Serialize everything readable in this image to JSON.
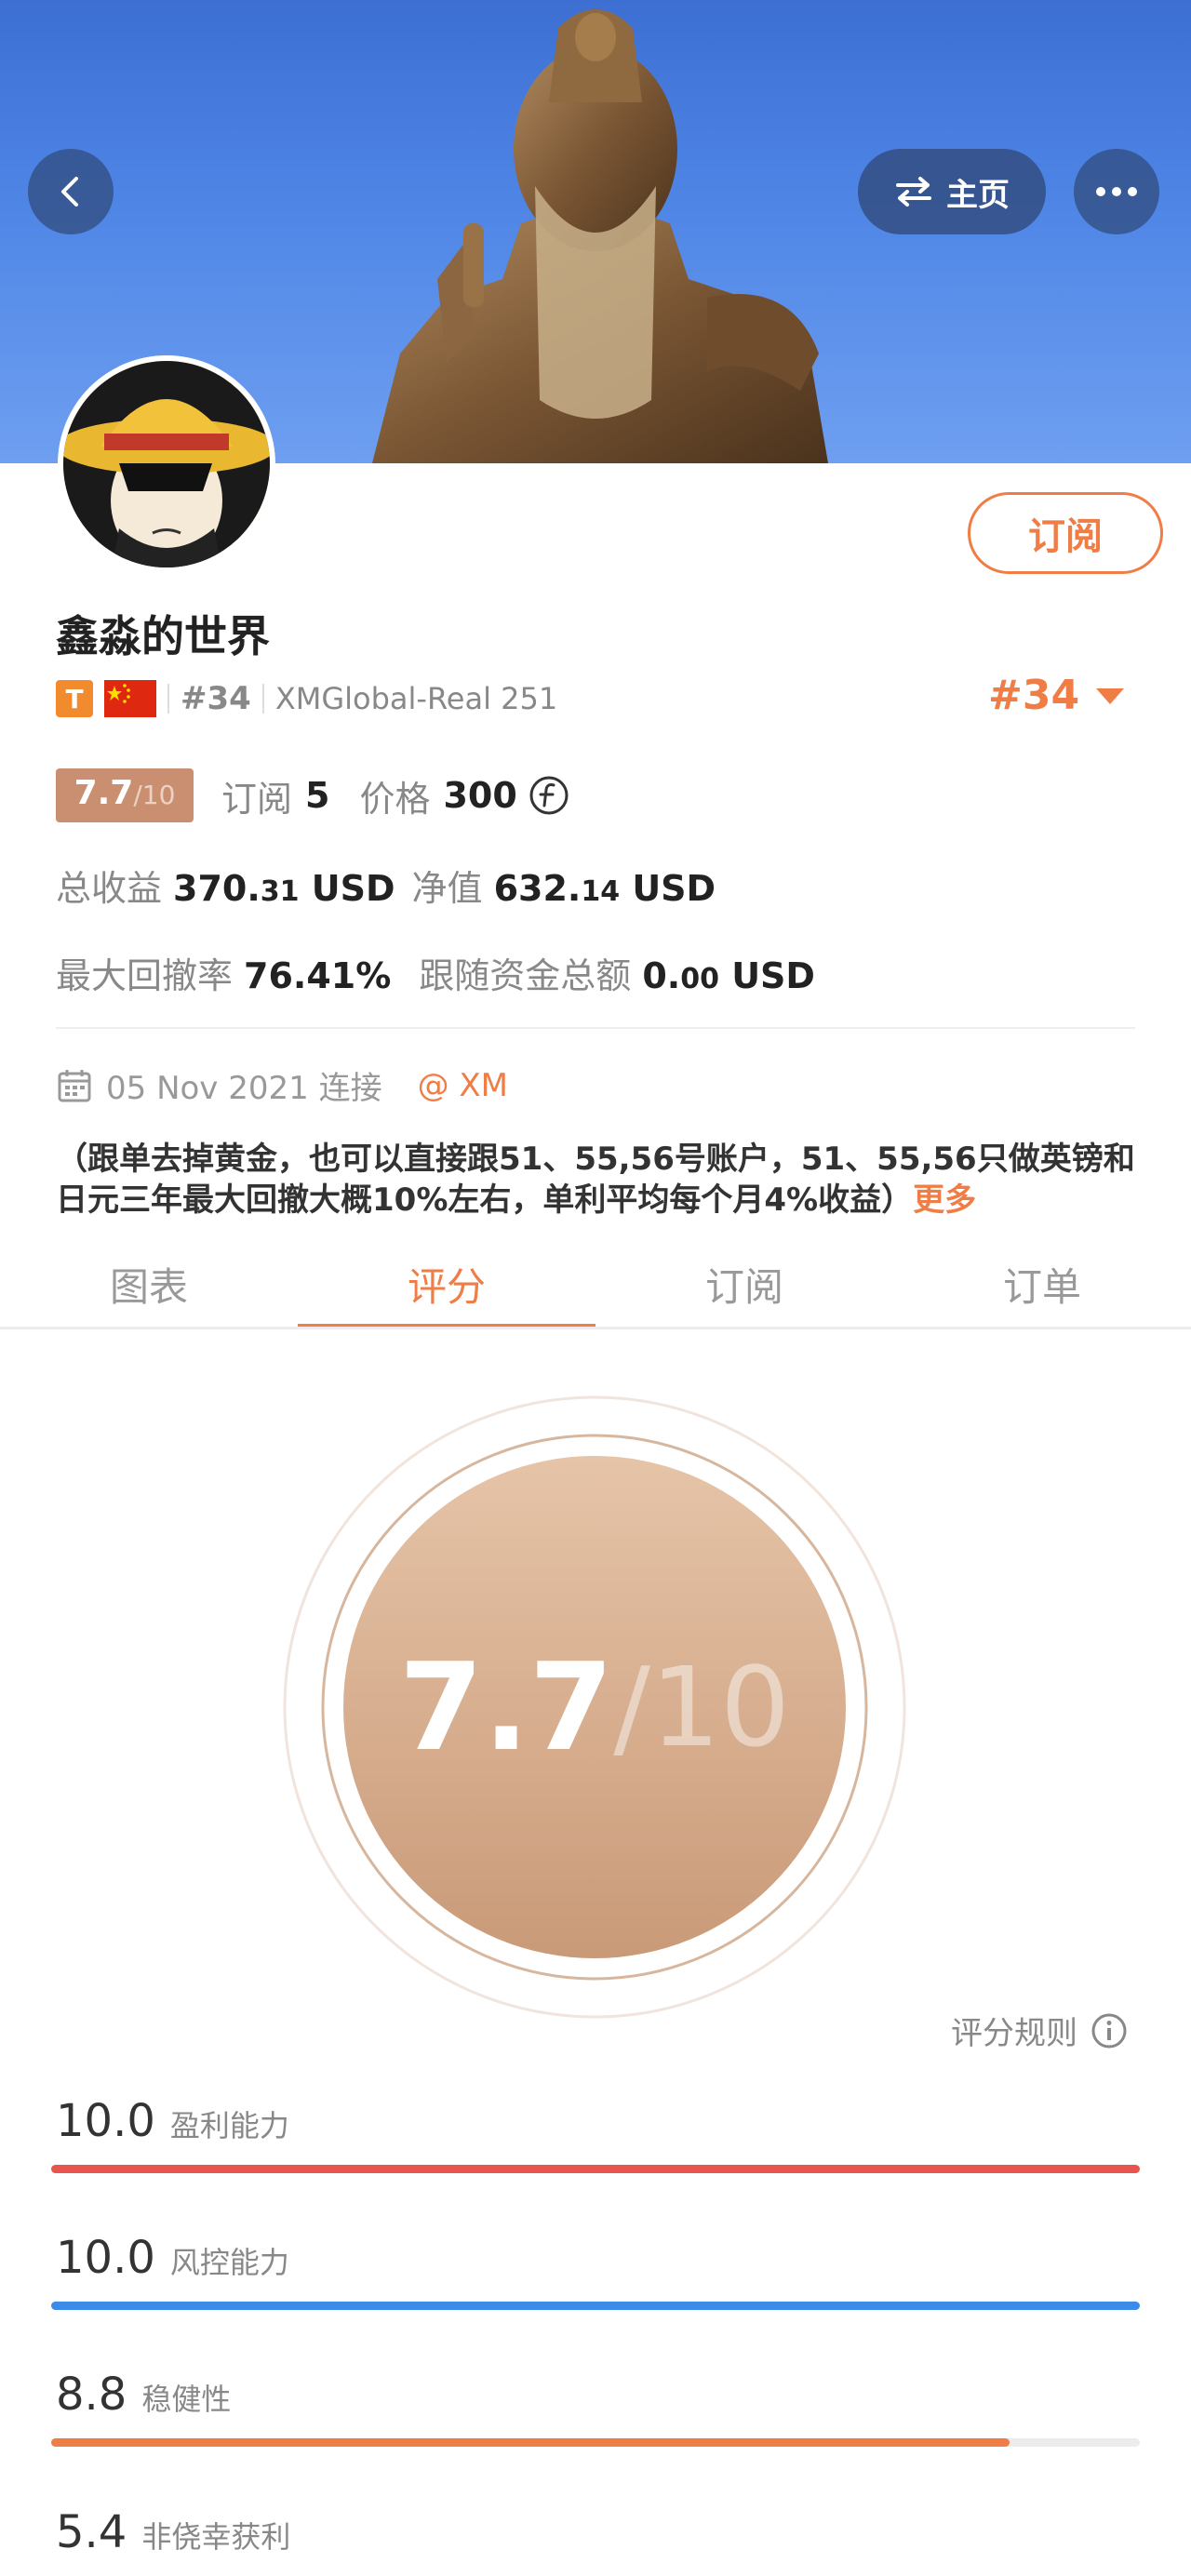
{
  "header": {
    "home_label": "主页",
    "colors": {
      "sky_top": "#3d6fd3",
      "button_bg": "#324e82",
      "accent": "#f07d45"
    }
  },
  "profile": {
    "name": "鑫淼的世界",
    "subscribe_label": "订阅",
    "tier_badge": "T",
    "rank_small": "#34",
    "broker": "XMGlobal-Real 251",
    "rank_right": "#34"
  },
  "stats": {
    "score_main": "7.7",
    "score_den": "/10",
    "subscribe_label": "订阅",
    "subscribe_count": "5",
    "price_label": "价格",
    "price_value": "300",
    "total_profit_label": "总收益",
    "total_profit_int": "370.",
    "total_profit_frac": "31",
    "total_profit_unit": "USD",
    "net_value_label": "净值",
    "net_value_int": "632.",
    "net_value_frac": "14",
    "net_value_unit": "USD",
    "max_drawdown_label": "最大回撤率",
    "max_drawdown_value": "76.41%",
    "follow_funds_label": "跟随资金总额",
    "follow_funds_int": "0.",
    "follow_funds_frac": "00",
    "follow_funds_unit": "USD"
  },
  "connection": {
    "date_text": "05 Nov 2021 连接",
    "broker_tag": "@ XM"
  },
  "description": {
    "text": "（跟单去掉黄金，也可以直接跟51、55,56号账户，51、55,56只做英镑和日元三年最大回撤大概10%左右，单利平均每个月4%收益）",
    "more_label": "更多"
  },
  "tabs": [
    {
      "label": "图表"
    },
    {
      "label": "评分"
    },
    {
      "label": "订阅"
    },
    {
      "label": "订单"
    }
  ],
  "score_panel": {
    "score_main": "7.7",
    "score_den": "/10",
    "rules_label": "评分规则"
  },
  "metrics": [
    {
      "value": "10.0",
      "label": "盈利能力",
      "fraction": 1.0,
      "color": "#e8544e"
    },
    {
      "value": "10.0",
      "label": "风控能力",
      "fraction": 1.0,
      "color": "#3d8be8"
    },
    {
      "value": "8.8",
      "label": "稳健性",
      "fraction": 0.88,
      "color": "#f07d45"
    },
    {
      "value": "5.4",
      "label": "非侥幸获利",
      "fraction": 0.54,
      "color": "#f5b042"
    }
  ]
}
